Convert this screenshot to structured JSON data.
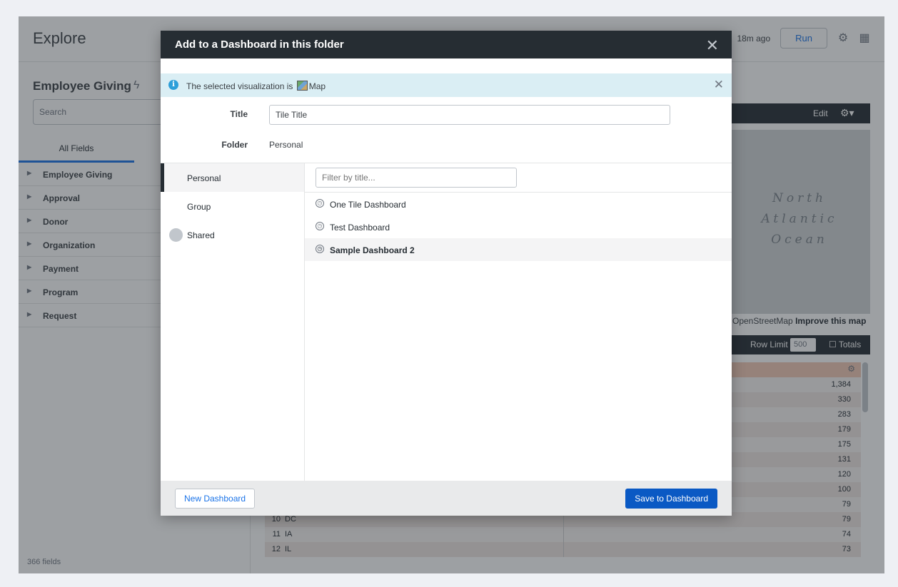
{
  "app": {
    "title": "Explore",
    "last_run": "18m ago",
    "run_label": "Run",
    "icons": [
      "gear-icon",
      "grid-icon"
    ]
  },
  "sidebar": {
    "model_title": "Employee Giving",
    "search_placeholder": "Search",
    "tab_label": "All Fields",
    "views": [
      {
        "label": "Employee Giving"
      },
      {
        "label": "Approval"
      },
      {
        "label": "Donor"
      },
      {
        "label": "Organization"
      },
      {
        "label": "Payment"
      },
      {
        "label": "Program"
      },
      {
        "label": "Request"
      }
    ],
    "field_count": "366 fields"
  },
  "visualization": {
    "edit_label": "Edit",
    "map_label_line1": "North",
    "map_label_line2": "Atlantic",
    "map_label_line3": "Ocean",
    "attribution_prefix": "OpenStreetMap",
    "attribution_link": "Improve this map"
  },
  "data_bar": {
    "row_limit_label": "Row Limit",
    "row_limit_value": "500",
    "totals_label": "Totals"
  },
  "results": {
    "rows": [
      {
        "num": "",
        "name": "",
        "value": "1,384"
      },
      {
        "num": "",
        "name": "",
        "value": "330"
      },
      {
        "num": "",
        "name": "",
        "value": "283"
      },
      {
        "num": "",
        "name": "",
        "value": "179"
      },
      {
        "num": "",
        "name": "",
        "value": "175"
      },
      {
        "num": "",
        "name": "",
        "value": "131"
      },
      {
        "num": "",
        "name": "",
        "value": "120"
      },
      {
        "num": "",
        "name": "",
        "value": "100"
      },
      {
        "num": "",
        "name": "",
        "value": "79"
      },
      {
        "num": "10",
        "name": "DC",
        "value": "79"
      },
      {
        "num": "11",
        "name": "IA",
        "value": "74"
      },
      {
        "num": "12",
        "name": "IL",
        "value": "73"
      }
    ]
  },
  "modal": {
    "title": "Add to a Dashboard in this folder",
    "info_prefix": "The selected visualization is",
    "info_viz": "Map",
    "title_label": "Title",
    "title_value": "Tile Title",
    "folder_label": "Folder",
    "folder_value": "Personal",
    "folders": [
      {
        "label": "Personal",
        "active": true
      },
      {
        "label": "Group",
        "active": false
      },
      {
        "label": "Shared",
        "active": false
      }
    ],
    "filter_placeholder": "Filter by title...",
    "dashboards": [
      {
        "label": "One Tile Dashboard"
      },
      {
        "label": "Test Dashboard"
      },
      {
        "label": "Sample Dashboard 2"
      }
    ],
    "new_dashboard_label": "New Dashboard",
    "save_label": "Save to Dashboard"
  }
}
